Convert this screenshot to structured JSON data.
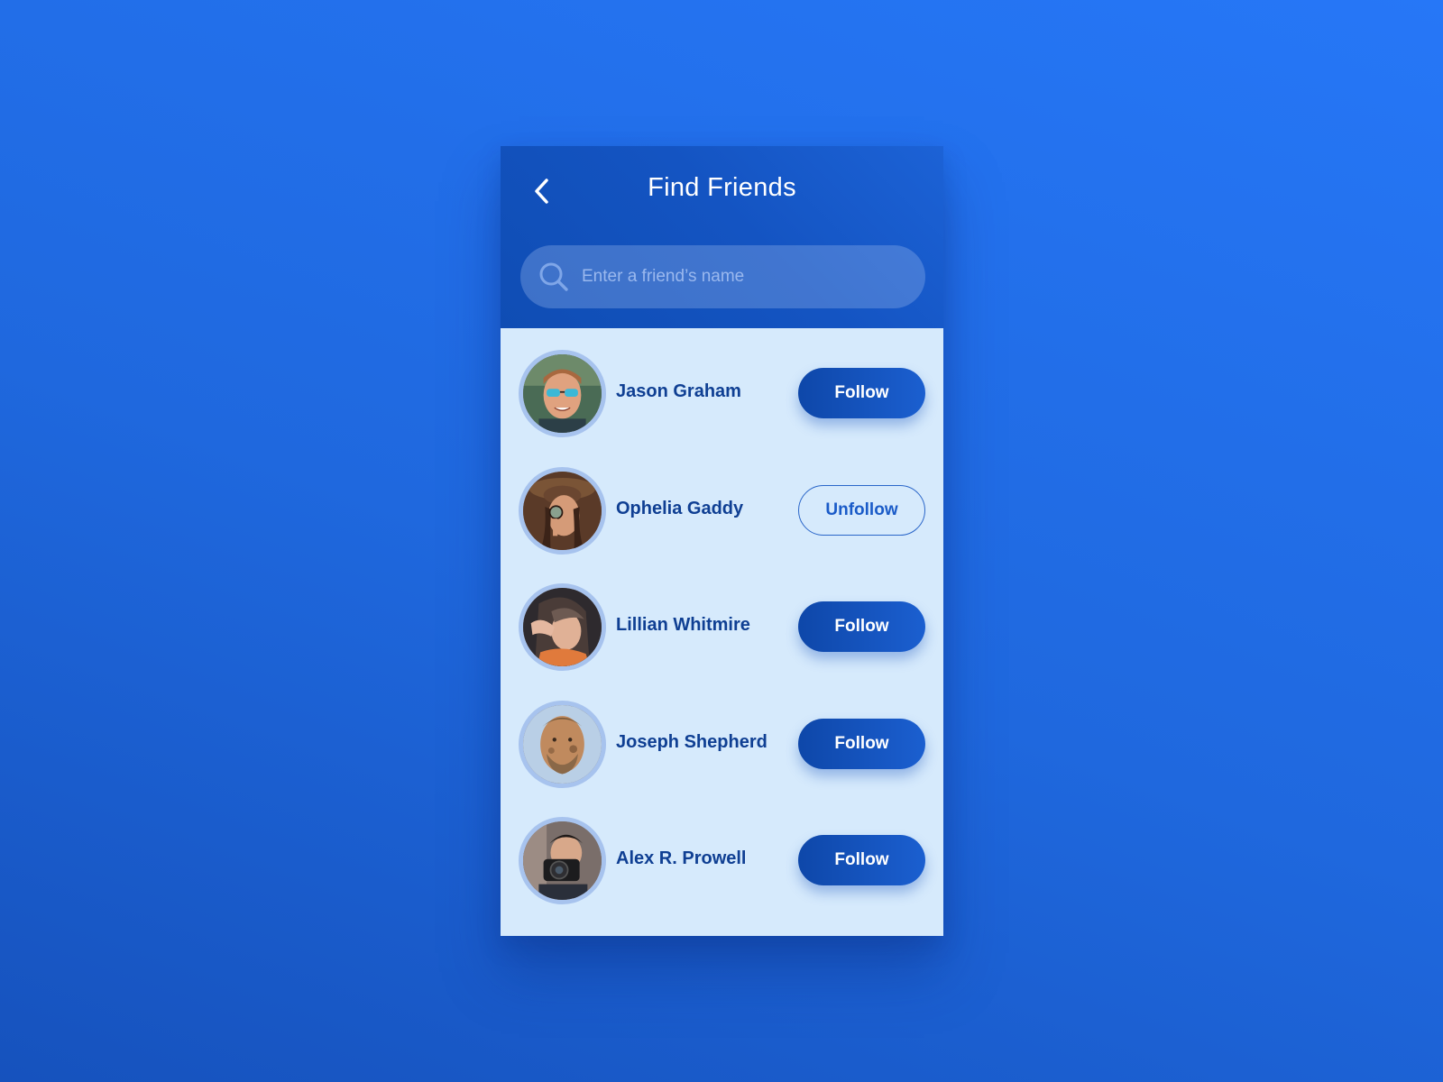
{
  "header": {
    "title": "Find Friends",
    "back_icon": "chevron-left-icon"
  },
  "search": {
    "placeholder": "Enter a friend’s name",
    "value": "",
    "icon": "search-icon"
  },
  "friends": [
    {
      "name": "Jason Graham",
      "action": "Follow"
    },
    {
      "name": "Ophelia Gaddy",
      "action": "Unfollow"
    },
    {
      "name": "Lillian Whitmire",
      "action": "Follow"
    },
    {
      "name": "Joseph Shepherd",
      "action": "Follow"
    },
    {
      "name": "Alex R. Prowell",
      "action": "Follow"
    }
  ],
  "colors": {
    "background": "#2271ea",
    "header": "#1454c2",
    "list_background": "#d6eafc",
    "name_text": "#0f3f93",
    "follow_button": "#1552bd",
    "avatar_ring": "#a7c3ee"
  }
}
